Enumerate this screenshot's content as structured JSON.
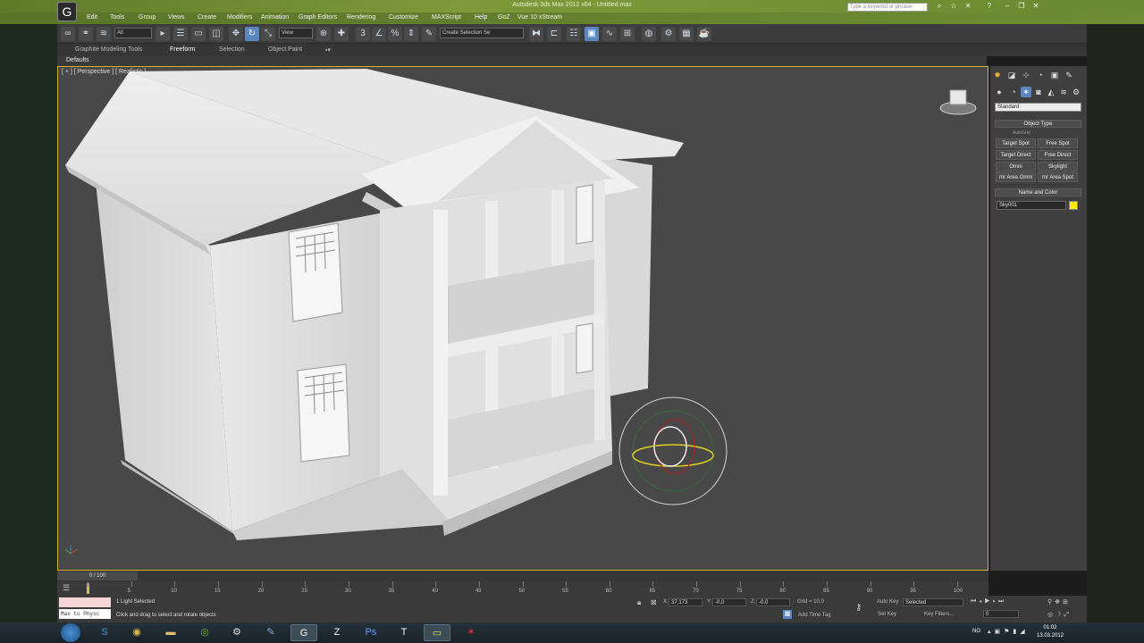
{
  "window": {
    "title": "Autodesk 3ds Max 2012 x64 - Untitled.max",
    "search_placeholder": "Type a keyword or phrase",
    "logo_glyph": "G"
  },
  "menu": [
    "Edit",
    "Tools",
    "Group",
    "Views",
    "Create",
    "Modifiers",
    "Animation",
    "Graph Editors",
    "Rendering",
    "Customize",
    "MAXScript",
    "Help",
    "GoZ",
    "Vue 10 xStream"
  ],
  "toolbar": {
    "filter_select": "All",
    "view_select": "View",
    "selection_set_placeholder": "Create Selection Se"
  },
  "ribbon": {
    "tabs": [
      "Graphite Modeling Tools",
      "Freeform",
      "Selection",
      "Object Paint"
    ],
    "active_tab": "Freeform",
    "defaults_label": "Defaults"
  },
  "viewport": {
    "label": "[ + ] [ Perspective ] [ Realistic ]"
  },
  "command_panel": {
    "dropdown": "Standard",
    "object_type_header": "Object Type",
    "autogrid": "AutoGrid",
    "buttons": [
      "Target Spot",
      "Free Spot",
      "Target Direct",
      "Free Direct",
      "Omni",
      "Skylight",
      "mr Area Omni",
      "mr Area Spot"
    ],
    "name_color_header": "Name and Color",
    "object_name": "Sky001",
    "object_color": "#ffea00"
  },
  "timeline": {
    "frame_display": "0 / 100",
    "ticks": [
      "0",
      "5",
      "10",
      "15",
      "20",
      "25",
      "30",
      "35",
      "40",
      "45",
      "50",
      "55",
      "60",
      "65",
      "70",
      "75",
      "80",
      "85",
      "90",
      "95",
      "100"
    ]
  },
  "status": {
    "maxscript_text": "Max to Physc",
    "selection_info": "1 Light Selected",
    "prompt": "Click and drag to select and rotate objects",
    "x_value": "37,173",
    "y_value": "-0,0",
    "z_value": "-0,0",
    "grid": "Grid = 10,0",
    "auto_key": "Auto Key",
    "key_mode": "Selected",
    "set_key": "Set Key",
    "key_filters": "Key Filters...",
    "add_time_tag": "Add Time Tag",
    "frame_field": "0"
  },
  "taskbar": {
    "lang": "NO",
    "time": "01:02",
    "date": "13.03.2012"
  }
}
